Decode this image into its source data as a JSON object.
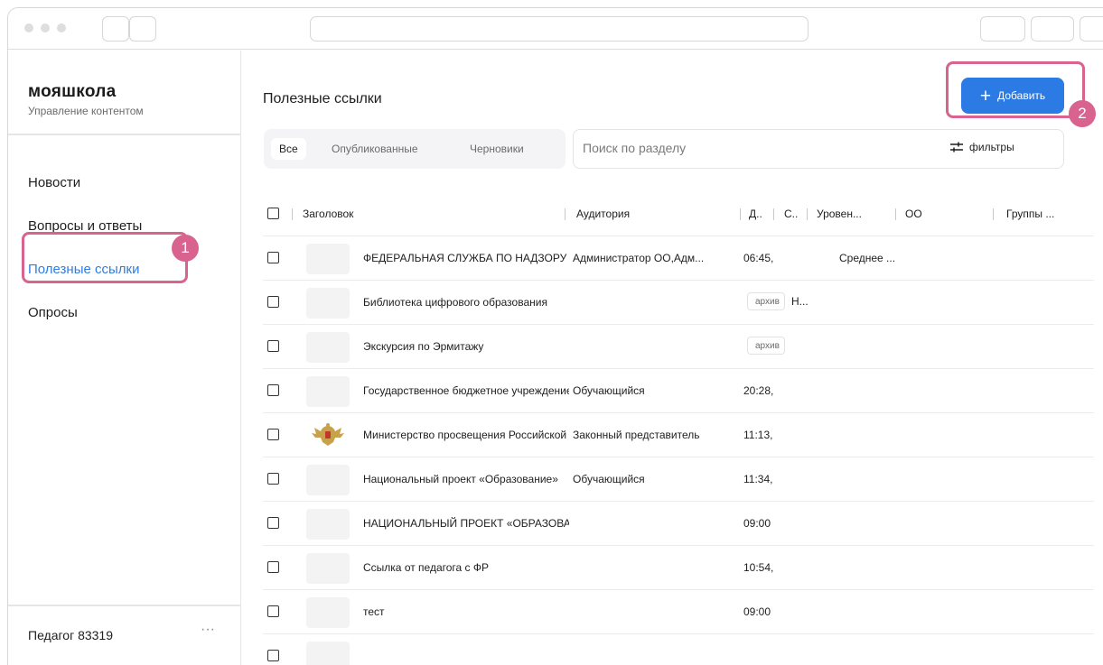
{
  "sidebar": {
    "brand": "мояшкола",
    "subtitle": "Управление контентом",
    "items": [
      {
        "label": "Новости"
      },
      {
        "label": "Вопросы и ответы"
      },
      {
        "label": "Полезные ссылки"
      },
      {
        "label": "Опросы"
      }
    ],
    "active_index": 2,
    "user": "Педагог 83319",
    "more": "···"
  },
  "main": {
    "title": "Полезные ссылки",
    "add_button": {
      "icon": "plus-icon",
      "label": "Добавить"
    },
    "tabs": [
      {
        "label": "Все"
      },
      {
        "label": "Опубликованные"
      },
      {
        "label": "Черновики"
      }
    ],
    "search": {
      "placeholder": "Поиск по разделу"
    },
    "filters": {
      "icon": "sliders-icon",
      "label": "фильтры"
    },
    "columns": [
      "Заголовок",
      "Аудитория",
      "Д..",
      "С..",
      "Уровен...",
      "ОО",
      "Группы ..."
    ],
    "rows": [
      {
        "title": "ФЕДЕРАЛЬНАЯ СЛУЖБА ПО НАДЗОРУ",
        "audience": "Администратор ОО,Адм...",
        "time": "06:45,",
        "level": "Среднее ..."
      },
      {
        "title": "Библиотека цифрового образования",
        "chip": "архив",
        "chip_extra": "Н..."
      },
      {
        "title": "Экскурсия по Эрмитажу",
        "chip": "архив"
      },
      {
        "title": "Государственное бюджетное учреждение",
        "audience": "Обучающийся",
        "time": "20:28,"
      },
      {
        "title": "Министерство просвещения Российской",
        "audience": "Законный представитель",
        "time": "11:13,",
        "emblem": true
      },
      {
        "title": "Национальный проект «Образование»",
        "audience": "Обучающийся",
        "time": "11:34,"
      },
      {
        "title": "НАЦИОНАЛЬНЫЙ ПРОЕКТ «ОБРАЗОВАНИЕ»",
        "time": "09:00"
      },
      {
        "title": "Ссылка от педагога с ФР",
        "time": "10:54,"
      },
      {
        "title": "тест",
        "time": "09:00"
      }
    ]
  },
  "annotations": [
    {
      "number": "1",
      "target": "Полезные ссылки"
    },
    {
      "number": "2",
      "target": "Добавить"
    }
  ],
  "colors": {
    "accent": "#2c7be5",
    "highlight": "#d9638f",
    "active_nav": "#2f7de1"
  }
}
